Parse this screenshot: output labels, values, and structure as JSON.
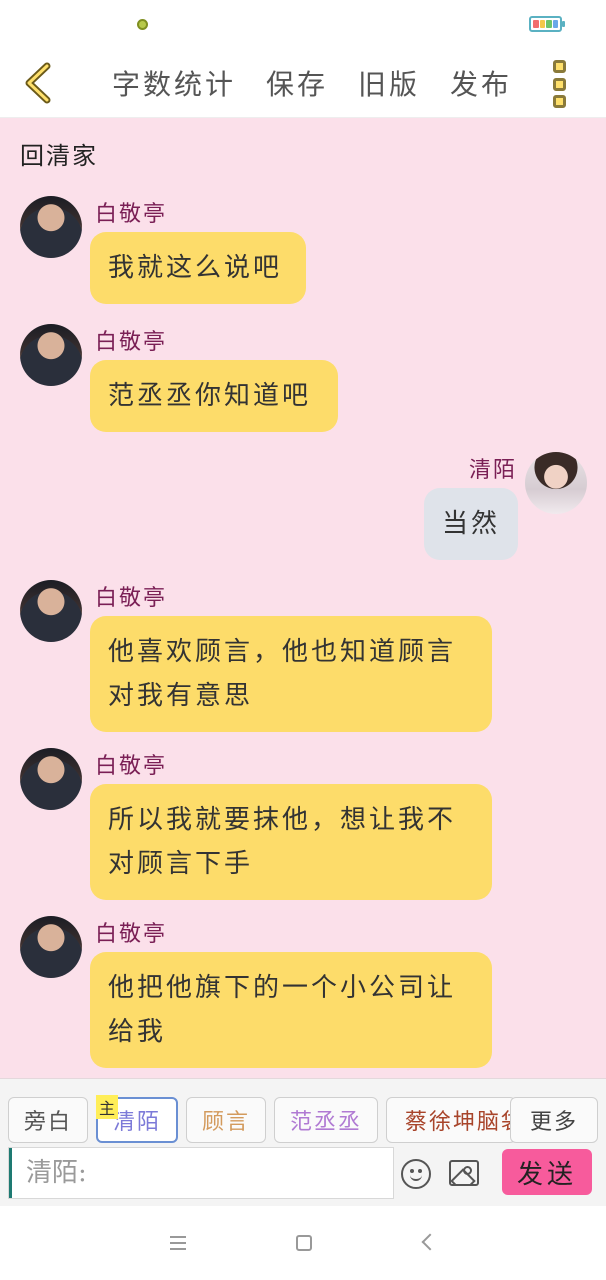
{
  "toolbar": {
    "actions": [
      "字数统计",
      "保存",
      "旧版",
      "发布"
    ]
  },
  "chat": {
    "section_title": "回清家",
    "messages": [
      {
        "sender": "白敬亭",
        "text": "我就这么说吧",
        "side": "left"
      },
      {
        "sender": "白敬亭",
        "text": "范丞丞你知道吧",
        "side": "left"
      },
      {
        "sender": "清陌",
        "text": "当然",
        "side": "right"
      },
      {
        "sender": "白敬亭",
        "text": "他喜欢顾言，他也知道顾言对我有意思",
        "side": "left"
      },
      {
        "sender": "白敬亭",
        "text": "所以我就要抹他，想让我不对顾言下手",
        "side": "left"
      },
      {
        "sender": "白敬亭",
        "text": "他把他旗下的一个小公司让给我",
        "side": "left"
      }
    ]
  },
  "composer": {
    "role_chips": [
      {
        "label": "旁白",
        "color": "#555555"
      },
      {
        "label": "清陌",
        "color": "#7c7ad8"
      },
      {
        "label": "顾言",
        "color": "#d39a5c"
      },
      {
        "label": "范丞丞",
        "color": "#b07ad3"
      },
      {
        "label": "蔡徐坤脑袋",
        "color": "#a8442a"
      },
      {
        "label": "更多",
        "color": "#444444"
      }
    ],
    "selected_tag": "主",
    "input_placeholder": "清陌:",
    "send_label": "发送"
  },
  "colors": {
    "chat_background": "#fbe0ea",
    "left_bubble": "#fddc6a",
    "right_bubble": "#dfe3ea",
    "sender_name": "#7a1f55",
    "send_button": "#f75b9c"
  },
  "icons": [
    "back-arrow-icon",
    "more-menu-icon",
    "emoji-icon",
    "image-icon",
    "nav-menu-icon",
    "nav-home-icon",
    "nav-back-icon",
    "battery-icon"
  ]
}
